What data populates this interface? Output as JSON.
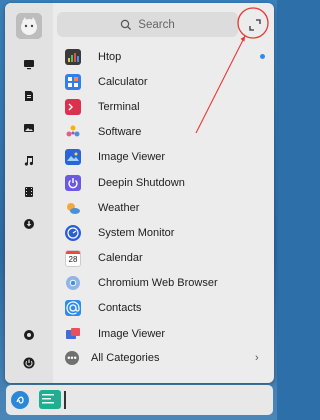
{
  "search": {
    "placeholder": "Search"
  },
  "apps": [
    {
      "label": "Htop",
      "icon": "htop-icon",
      "color": "#3a3a3a",
      "new": true
    },
    {
      "label": "Calculator",
      "icon": "calculator-icon",
      "color": "#2f80ed",
      "new": false
    },
    {
      "label": "Terminal",
      "icon": "terminal-icon",
      "color": "#d9314e",
      "new": false
    },
    {
      "label": "Software",
      "icon": "software-icon",
      "color": "#e85b8a",
      "new": false
    },
    {
      "label": "Image Viewer",
      "icon": "image-viewer-icon",
      "color": "#2a64d6",
      "new": false
    },
    {
      "label": "Deepin Shutdown",
      "icon": "shutdown-icon",
      "color": "#6a5ae0",
      "new": false
    },
    {
      "label": "Weather",
      "icon": "weather-icon",
      "color": "#f2a93b",
      "new": false
    },
    {
      "label": "System Monitor",
      "icon": "system-monitor-icon",
      "color": "#2a5fd6",
      "new": false
    },
    {
      "label": "Calendar",
      "icon": "calendar-icon",
      "color": "#ffffff",
      "new": false
    },
    {
      "label": "Chromium Web Browser",
      "icon": "chromium-icon",
      "color": "#4a90d9",
      "new": false
    },
    {
      "label": "Contacts",
      "icon": "contacts-icon",
      "color": "#2f8be8",
      "new": false
    },
    {
      "label": "Image Viewer",
      "icon": "image-viewer-icon",
      "color": "#3a6fd8",
      "new": false
    }
  ],
  "calendar_day": "28",
  "all_categories": {
    "label": "All Categories",
    "chevron": "›"
  },
  "sidebar_icons": [
    "desktop-icon",
    "document-icon",
    "picture-icon",
    "music-icon",
    "video-icon",
    "download-icon"
  ],
  "bottom_icons": [
    "settings-icon",
    "power-icon"
  ],
  "colors": {
    "accent": "#2d8ce8",
    "annotation": "#e53935"
  }
}
